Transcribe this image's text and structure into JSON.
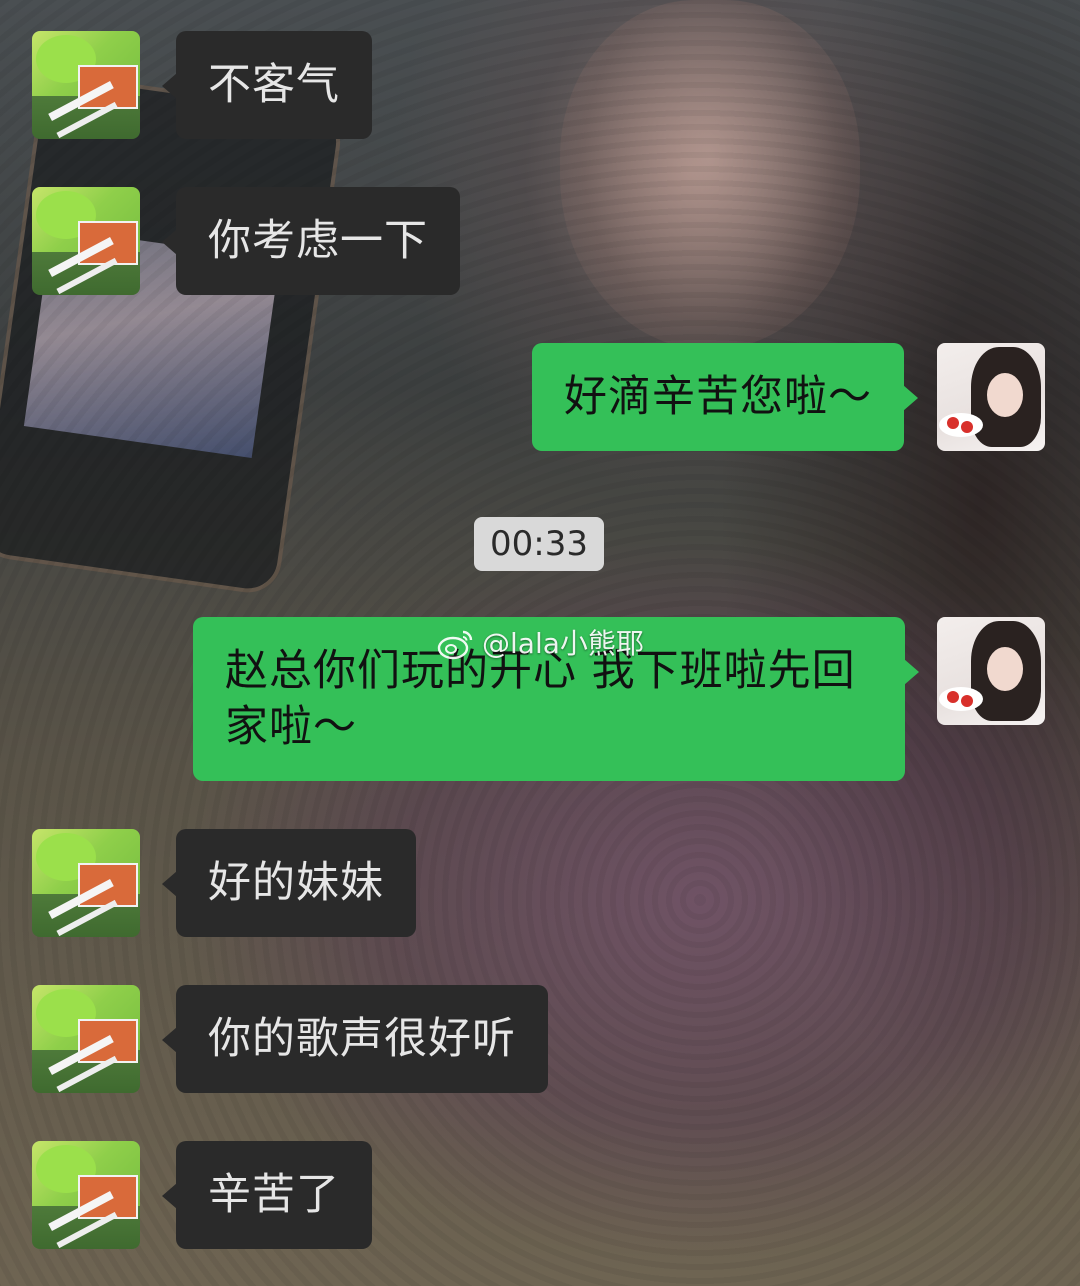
{
  "chat": {
    "messages": [
      {
        "side": "in",
        "text": "不客气",
        "avatar": "house-avatar"
      },
      {
        "side": "in",
        "text": "你考虑一下",
        "avatar": "house-avatar"
      },
      {
        "side": "out",
        "text": "好滴辛苦您啦～",
        "avatar": "girl-avatar"
      },
      {
        "side": "out",
        "text": "赵总你们玩的开心 我下班啦先回家啦～",
        "avatar": "girl-avatar"
      },
      {
        "side": "in",
        "text": "好的妹妹",
        "avatar": "house-avatar"
      },
      {
        "side": "in",
        "text": "你的歌声很好听",
        "avatar": "house-avatar"
      },
      {
        "side": "in",
        "text": "辛苦了",
        "avatar": "house-avatar"
      }
    ],
    "timestamp": "00:33"
  },
  "watermark": {
    "text": "@lala小熊耶",
    "icon": "weibo-icon"
  },
  "colors": {
    "incoming_bubble": "#2a2a2a",
    "outgoing_bubble": "#34c058",
    "timestamp_bg": "#d9d9d9"
  }
}
